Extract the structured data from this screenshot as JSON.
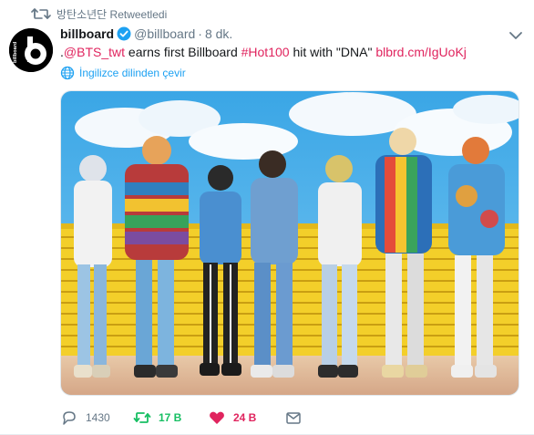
{
  "context": {
    "icon": "retweet-icon",
    "text": "방탄소년단 Retweetledi"
  },
  "author": {
    "name": "billboard",
    "handle": "@billboard",
    "separator": "·",
    "time": "8 dk.",
    "avatar_text": "billboard",
    "avatar_letter": "b"
  },
  "text": {
    "prefix": ".",
    "mention": "@BTS_twt",
    "part1": " earns first Billboard ",
    "hashtag": "#Hot100",
    "part2": " hit with \"DNA\" ",
    "url": "blbrd.cm/IgUoKj"
  },
  "translate": {
    "icon": "globe-icon",
    "label": "İngilizce dilinden çevir"
  },
  "actions": {
    "reply_count": "1430",
    "retweet_count": "17 B",
    "like_count": "24 B"
  },
  "colors": {
    "link": "#e0245e",
    "retweet_active": "#17bf63",
    "like_active": "#e0245e",
    "translate": "#1da1f2",
    "muted": "#657786"
  }
}
